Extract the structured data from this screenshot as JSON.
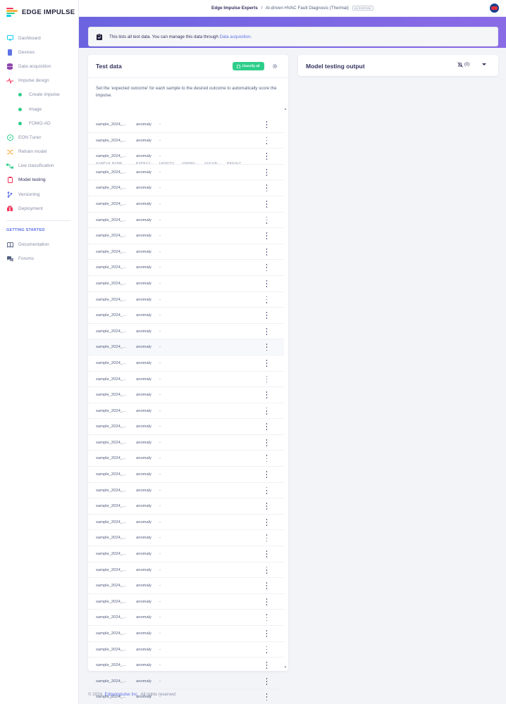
{
  "brand": {
    "name": "EDGE IMPULSE"
  },
  "header": {
    "org": "Edge Impulse Experts",
    "separator": "/",
    "project": "AI-driven HVAC Fault Diagnosis (Thermal)",
    "badge": "ENTERPRISE"
  },
  "sidebar": {
    "items": [
      {
        "label": "Dashboard",
        "icon": "monitor-icon",
        "color": "#11cdef"
      },
      {
        "label": "Devices",
        "icon": "device-icon",
        "color": "#5e72e4"
      },
      {
        "label": "Data acquisition",
        "icon": "database-icon",
        "color": "#8e44ad"
      },
      {
        "label": "Impulse design",
        "icon": "pulse-icon",
        "color": "#f5365c"
      },
      {
        "label": "Create impulse",
        "sub": true
      },
      {
        "label": "Image",
        "sub": true
      },
      {
        "label": "FOMO-AD",
        "sub": true
      },
      {
        "label": "EON Tuner",
        "icon": "compass-icon",
        "color": "#2dce89"
      },
      {
        "label": "Retrain model",
        "icon": "shuffle-icon",
        "color": "#fbb140"
      },
      {
        "label": "Live classification",
        "icon": "flow-icon",
        "color": "#2dce89"
      },
      {
        "label": "Model testing",
        "icon": "clipboard-icon",
        "color": "#f5365c",
        "active": true
      },
      {
        "label": "Versioning",
        "icon": "branch-icon",
        "color": "#5e72e4"
      },
      {
        "label": "Deployment",
        "icon": "gift-icon",
        "color": "#f5365c"
      }
    ],
    "section_heading": "GETTING STARTED",
    "help": [
      {
        "label": "Documentation",
        "icon": "book-icon"
      },
      {
        "label": "Forums",
        "icon": "chat-icon"
      }
    ]
  },
  "info": {
    "text": "This lists all test data. You can manage this data through ",
    "link": "Data acquisition",
    "end": "."
  },
  "test_card": {
    "title": "Test data",
    "classify_label": "Classify all",
    "description": "Set the 'expected outcome' for each sample to the desired outcome to automatically score the impulse.",
    "columns": [
      "SAMPLE NAME",
      "EXPECT...",
      "LENGTH",
      "ANOMA...",
      "ACCUR...",
      "RESULT"
    ],
    "rows": [
      {
        "name": "sample_2024_...",
        "expected": "anomaly",
        "length": "-"
      },
      {
        "name": "sample_2024_...",
        "expected": "anomaly",
        "length": "-"
      },
      {
        "name": "sample_2024_...",
        "expected": "anomaly",
        "length": "-"
      },
      {
        "name": "sample_2024_...",
        "expected": "anomaly",
        "length": "-"
      },
      {
        "name": "sample_2024_...",
        "expected": "anomaly",
        "length": "-"
      },
      {
        "name": "sample_2024_...",
        "expected": "anomaly",
        "length": "-"
      },
      {
        "name": "sample_2024_...",
        "expected": "anomaly",
        "length": "-"
      },
      {
        "name": "sample_2024_...",
        "expected": "anomaly",
        "length": "-"
      },
      {
        "name": "sample_2024_...",
        "expected": "anomaly",
        "length": "-"
      },
      {
        "name": "sample_2024_...",
        "expected": "anomaly",
        "length": "-"
      },
      {
        "name": "sample_2024_...",
        "expected": "anomaly",
        "length": "-"
      },
      {
        "name": "sample_2024_...",
        "expected": "anomaly",
        "length": "-"
      },
      {
        "name": "sample_2024_...",
        "expected": "anomaly",
        "length": "-"
      },
      {
        "name": "sample_2024_...",
        "expected": "anomaly",
        "length": "-"
      },
      {
        "name": "sample_2024_...",
        "expected": "anomaly",
        "length": "-"
      },
      {
        "name": "sample_2024_...",
        "expected": "anomaly",
        "length": "-"
      },
      {
        "name": "sample_2024_...",
        "expected": "anomaly",
        "length": "-"
      },
      {
        "name": "sample_2024_...",
        "expected": "anomaly",
        "length": "-"
      },
      {
        "name": "sample_2024_...",
        "expected": "anomaly",
        "length": "-"
      },
      {
        "name": "sample_2024_...",
        "expected": "anomaly",
        "length": "-"
      },
      {
        "name": "sample_2024_...",
        "expected": "anomaly",
        "length": "-"
      },
      {
        "name": "sample_2024_...",
        "expected": "anomaly",
        "length": "-"
      },
      {
        "name": "sample_2024_...",
        "expected": "anomaly",
        "length": "-"
      },
      {
        "name": "sample_2024_...",
        "expected": "anomaly",
        "length": "-"
      },
      {
        "name": "sample_2024_...",
        "expected": "anomaly",
        "length": "-"
      },
      {
        "name": "sample_2024_...",
        "expected": "anomaly",
        "length": "-"
      },
      {
        "name": "sample_2024_...",
        "expected": "anomaly",
        "length": "-"
      },
      {
        "name": "sample_2024_...",
        "expected": "anomaly",
        "length": "-"
      },
      {
        "name": "sample_2024_...",
        "expected": "anomaly",
        "length": "-"
      },
      {
        "name": "sample_2024_...",
        "expected": "anomaly",
        "length": "-"
      },
      {
        "name": "sample_2024_...",
        "expected": "anomaly",
        "length": "-"
      },
      {
        "name": "sample_2024_...",
        "expected": "anomaly",
        "length": "-"
      },
      {
        "name": "sample_2024_...",
        "expected": "anomaly",
        "length": "-"
      },
      {
        "name": "sample_2024_...",
        "expected": "anomaly",
        "length": "-"
      },
      {
        "name": "sample_2024_...",
        "expected": "anomaly",
        "length": "-"
      },
      {
        "name": "sample_2024_...",
        "expected": "anomaly",
        "length": "-"
      },
      {
        "name": "sample_2024_...",
        "expected": "anomaly",
        "length": "-"
      }
    ],
    "highlighted_row": 14
  },
  "output_card": {
    "title": "Model testing output",
    "notification_count": "(0)"
  },
  "footer": {
    "prefix": "© 2024 ",
    "company": "EdgeImpulse Inc.",
    "suffix": " All rights reserved"
  },
  "colors": {
    "accent": "#5e72e4",
    "success": "#2dce89",
    "band_start": "#6b63e0",
    "band_end": "#8a6be6"
  }
}
